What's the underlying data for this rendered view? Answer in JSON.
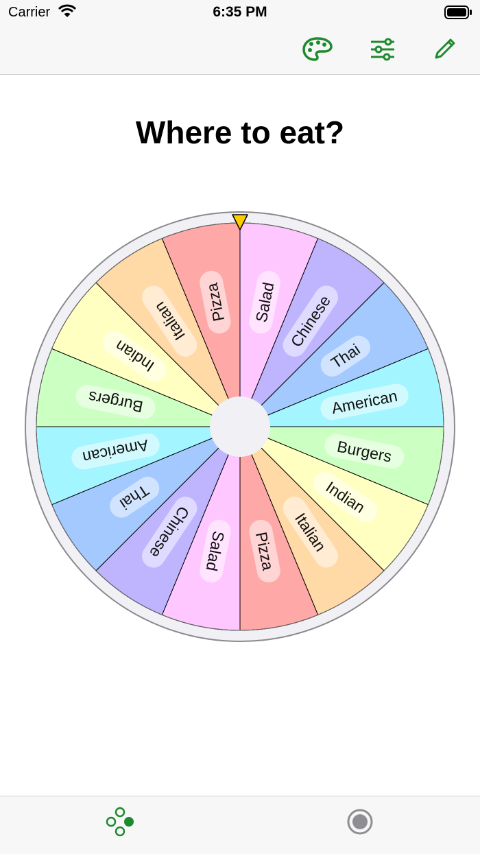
{
  "status": {
    "carrier": "Carrier",
    "time": "6:35 PM"
  },
  "nav": {
    "accent": "#1e8a2e",
    "buttons": [
      {
        "name": "palette-button",
        "icon": "palette-icon"
      },
      {
        "name": "settings-button",
        "icon": "sliders-icon"
      },
      {
        "name": "edit-button",
        "icon": "pencil-icon"
      }
    ]
  },
  "title": "Where to eat?",
  "wheel": {
    "pointer_color": "#ffcc00",
    "hub_color": "#f0f0f5",
    "rim_color": "#f0f0f5",
    "segments": [
      {
        "label": "Salad",
        "color": "#ffc7ff"
      },
      {
        "label": "Chinese",
        "color": "#bfb5ff"
      },
      {
        "label": "Thai",
        "color": "#a3c9ff"
      },
      {
        "label": "American",
        "color": "#a3f5ff"
      },
      {
        "label": "Burgers",
        "color": "#ccffc2"
      },
      {
        "label": "Indian",
        "color": "#ffffc2"
      },
      {
        "label": "Italian",
        "color": "#ffd9a6"
      },
      {
        "label": "Pizza",
        "color": "#ffa8a8"
      },
      {
        "label": "Salad",
        "color": "#ffc7ff"
      },
      {
        "label": "Chinese",
        "color": "#bfb5ff"
      },
      {
        "label": "Thai",
        "color": "#a3c9ff"
      },
      {
        "label": "American",
        "color": "#a3f5ff"
      },
      {
        "label": "Burgers",
        "color": "#ccffc2"
      },
      {
        "label": "Indian",
        "color": "#ffffc2"
      },
      {
        "label": "Italian",
        "color": "#ffd9a6"
      },
      {
        "label": "Pizza",
        "color": "#ffa8a8"
      }
    ]
  },
  "tabs": [
    {
      "name": "tab-wheels",
      "icon": "wheels-icon",
      "selected": true
    },
    {
      "name": "tab-spin",
      "icon": "record-icon",
      "selected": false
    }
  ]
}
